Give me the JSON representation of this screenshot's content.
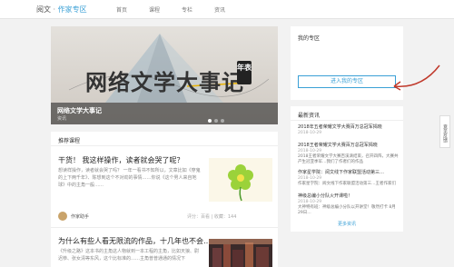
{
  "header": {
    "logo_brand": "阅文",
    "logo_sep": " · ",
    "logo_zone": "作家专区",
    "nav": [
      "首页",
      "课程",
      "专栏",
      "资讯"
    ]
  },
  "banner": {
    "headline": "网络文学大事记",
    "badge": "年表",
    "caption": "网络文学大事记",
    "subcaption": "资讯",
    "slides_total": 3,
    "slides_active": 1
  },
  "courses": {
    "section_title": "推荐课程",
    "items": [
      {
        "title": "干货！ 我这样操作，读者就会哭了呢？",
        "desc": "想读样操作，读者就会哭了吗？ 一年一看书不知所以，文章比如《穿鬼的上下两千年》、陈想到这个不对劲的事情……你说《这个男人来自地球》中的主角一般……",
        "author": "作家助手",
        "meta": "评分：百看 | 收藏：144",
        "thumb": "green-flower"
      },
      {
        "title": "为什么有些人看无限流的作品，十几年也不会…",
        "desc": "《升级之路》这本书的主角这人物就到一本工程的主角，比如天狼、尉迟恭、张女清等东风，这个比标准的……主角普普通通的情况下",
        "author": "",
        "meta": "",
        "thumb": "city-night"
      }
    ]
  },
  "myzone": {
    "title": "我的专区",
    "enter_label": "进入我的专区"
  },
  "news": {
    "title": "最新资讯",
    "items": [
      {
        "title": "2018年五者荣耀文学大赛百万总冠军揭晓",
        "date": "2018-10-29",
        "body": ""
      },
      {
        "title": "2018王者荣耀文学大赛百万总冠军揭晓",
        "date": "2018-10-29",
        "body": "2018王者荣耀文学大赛百溪滴结束，召开四阵，大赛共产生冠亚季军…我们了作者们的作品"
      },
      {
        "title": "作家星学院：阅文线下作家联盟活动第三…",
        "date": "2018-10-29",
        "body": "作家星学院：阅文线下作家联盟活动第三…王者作家们"
      },
      {
        "title": "神级总编小分队火开课啦！",
        "date": "2018-10-29",
        "body": "大神特有班：神级总编小分队以开讲堂！敬然打卡 8月29日…"
      }
    ],
    "more_label": "更多资讯"
  },
  "feedback": {
    "label": "意见反馈"
  },
  "colors": {
    "accent": "#3aa0d6",
    "annotation_arrow": "#c0392b"
  }
}
